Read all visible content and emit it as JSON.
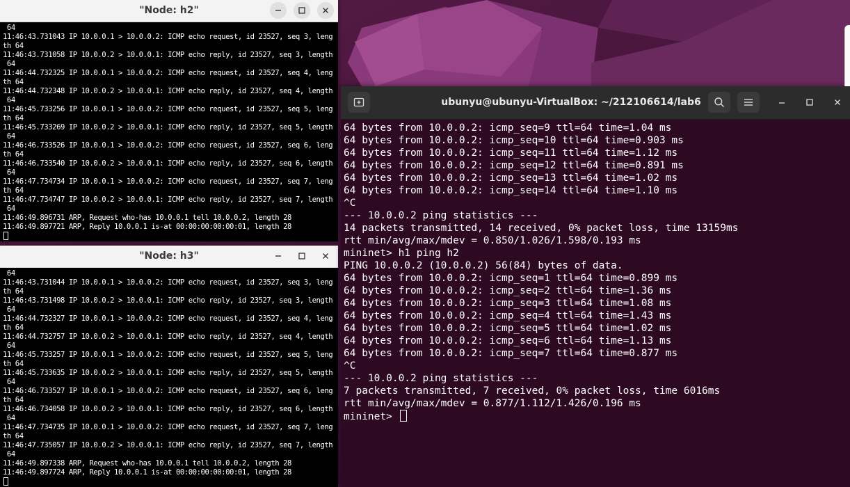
{
  "h2_window": {
    "title": "\"Node: h2\"",
    "lines": [
      " 64",
      "11:46:43.731043 IP 10.0.0.1 > 10.0.0.2: ICMP echo request, id 23527, seq 3, leng",
      "th 64",
      "11:46:43.731058 IP 10.0.0.2 > 10.0.0.1: ICMP echo reply, id 23527, seq 3, length",
      " 64",
      "11:46:44.732325 IP 10.0.0.1 > 10.0.0.2: ICMP echo request, id 23527, seq 4, leng",
      "th 64",
      "11:46:44.732348 IP 10.0.0.2 > 10.0.0.1: ICMP echo reply, id 23527, seq 4, length",
      " 64",
      "11:46:45.733256 IP 10.0.0.1 > 10.0.0.2: ICMP echo request, id 23527, seq 5, leng",
      "th 64",
      "11:46:45.733269 IP 10.0.0.2 > 10.0.0.1: ICMP echo reply, id 23527, seq 5, length",
      " 64",
      "11:46:46.733526 IP 10.0.0.1 > 10.0.0.2: ICMP echo request, id 23527, seq 6, leng",
      "th 64",
      "11:46:46.733540 IP 10.0.0.2 > 10.0.0.1: ICMP echo reply, id 23527, seq 6, length",
      " 64",
      "11:46:47.734734 IP 10.0.0.1 > 10.0.0.2: ICMP echo request, id 23527, seq 7, leng",
      "th 64",
      "11:46:47.734747 IP 10.0.0.2 > 10.0.0.1: ICMP echo reply, id 23527, seq 7, length",
      " 64",
      "11:46:49.896731 ARP, Request who-has 10.0.0.1 tell 10.0.0.2, length 28",
      "11:46:49.897721 ARP, Reply 10.0.0.1 is-at 00:00:00:00:00:01, length 28"
    ]
  },
  "h3_window": {
    "title": "\"Node: h3\"",
    "lines": [
      " 64",
      "11:46:43.731044 IP 10.0.0.1 > 10.0.0.2: ICMP echo request, id 23527, seq 3, leng",
      "th 64",
      "11:46:43.731498 IP 10.0.0.2 > 10.0.0.1: ICMP echo reply, id 23527, seq 3, length",
      " 64",
      "11:46:44.732327 IP 10.0.0.1 > 10.0.0.2: ICMP echo request, id 23527, seq 4, leng",
      "th 64",
      "11:46:44.732757 IP 10.0.0.2 > 10.0.0.1: ICMP echo reply, id 23527, seq 4, length",
      " 64",
      "11:46:45.733257 IP 10.0.0.1 > 10.0.0.2: ICMP echo request, id 23527, seq 5, leng",
      "th 64",
      "11:46:45.733635 IP 10.0.0.2 > 10.0.0.1: ICMP echo reply, id 23527, seq 5, length",
      " 64",
      "11:46:46.733527 IP 10.0.0.1 > 10.0.0.2: ICMP echo request, id 23527, seq 6, leng",
      "th 64",
      "11:46:46.734058 IP 10.0.0.2 > 10.0.0.1: ICMP echo reply, id 23527, seq 6, length",
      " 64",
      "11:46:47.734735 IP 10.0.0.1 > 10.0.0.2: ICMP echo request, id 23527, seq 7, leng",
      "th 64",
      "11:46:47.735057 IP 10.0.0.2 > 10.0.0.1: ICMP echo reply, id 23527, seq 7, length",
      " 64",
      "11:46:49.897338 ARP, Request who-has 10.0.0.1 tell 10.0.0.2, length 28",
      "11:46:49.897724 ARP, Reply 10.0.0.1 is-at 00:00:00:00:00:01, length 28"
    ]
  },
  "terminal": {
    "title": "ubunyu@ubunyu-VirtualBox: ~/212106614/lab6",
    "lines": [
      "64 bytes from 10.0.0.2: icmp_seq=9 ttl=64 time=1.04 ms",
      "64 bytes from 10.0.0.2: icmp_seq=10 ttl=64 time=0.903 ms",
      "64 bytes from 10.0.0.2: icmp_seq=11 ttl=64 time=1.12 ms",
      "64 bytes from 10.0.0.2: icmp_seq=12 ttl=64 time=0.891 ms",
      "64 bytes from 10.0.0.2: icmp_seq=13 ttl=64 time=1.02 ms",
      "64 bytes from 10.0.0.2: icmp_seq=14 ttl=64 time=1.10 ms",
      "^C",
      "--- 10.0.0.2 ping statistics ---",
      "14 packets transmitted, 14 received, 0% packet loss, time 13159ms",
      "rtt min/avg/max/mdev = 0.850/1.026/1.598/0.193 ms",
      "mininet> h1 ping h2",
      "PING 10.0.0.2 (10.0.0.2) 56(84) bytes of data.",
      "64 bytes from 10.0.0.2: icmp_seq=1 ttl=64 time=0.899 ms",
      "64 bytes from 10.0.0.2: icmp_seq=2 ttl=64 time=1.36 ms",
      "64 bytes from 10.0.0.2: icmp_seq=3 ttl=64 time=1.08 ms",
      "64 bytes from 10.0.0.2: icmp_seq=4 ttl=64 time=1.43 ms",
      "64 bytes from 10.0.0.2: icmp_seq=5 ttl=64 time=1.02 ms",
      "64 bytes from 10.0.0.2: icmp_seq=6 ttl=64 time=1.13 ms",
      "64 bytes from 10.0.0.2: icmp_seq=7 ttl=64 time=0.877 ms",
      "^C",
      "--- 10.0.0.2 ping statistics ---",
      "7 packets transmitted, 7 received, 0% packet loss, time 6016ms",
      "rtt min/avg/max/mdev = 0.877/1.112/1.426/0.196 ms"
    ],
    "prompt": "mininet> "
  },
  "colors": {
    "terminal_bg": "#2d0922",
    "header_bg": "#2c2c2c",
    "xterm_bg": "#000000",
    "xterm_title_bg": "#f3f3f3"
  },
  "icons": [
    "new-tab-icon",
    "search-icon",
    "menu-icon",
    "minimize-icon",
    "maximize-icon",
    "close-icon"
  ]
}
